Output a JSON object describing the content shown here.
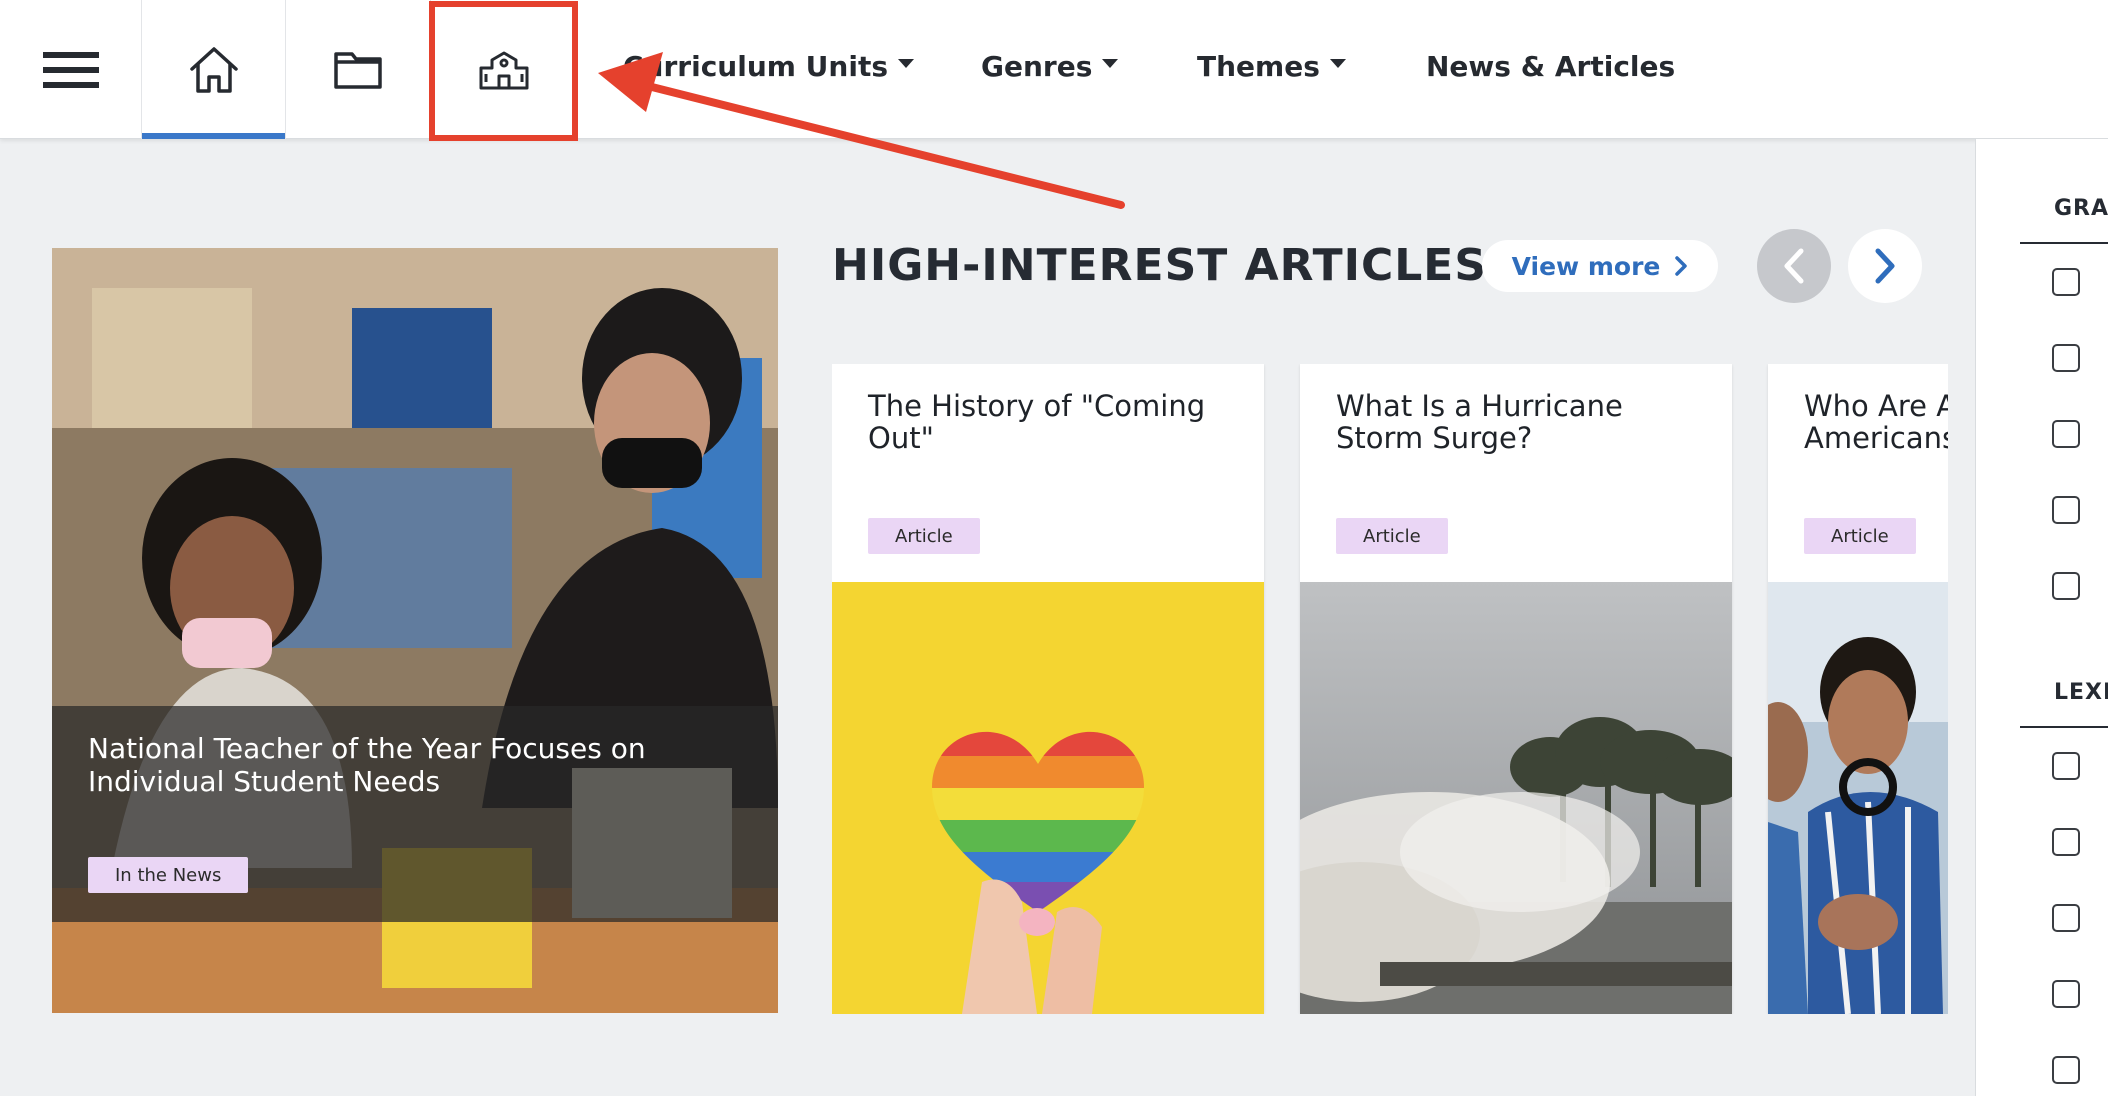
{
  "nav": {
    "icons": {
      "menu": "hamburger-menu-icon",
      "home": "home-icon",
      "folder": "folder-icon",
      "school": "school-building-icon"
    },
    "links": [
      {
        "label": "Curriculum Units",
        "dropdown": true
      },
      {
        "label": "Genres",
        "dropdown": true
      },
      {
        "label": "Themes",
        "dropdown": true
      },
      {
        "label": "News & Articles",
        "dropdown": false
      }
    ],
    "active_tab": "home"
  },
  "feature": {
    "title": "National Teacher of the Year Focuses on Individual Student Needs",
    "tag": "In the News"
  },
  "section": {
    "title": "HIGH-INTEREST ARTICLES",
    "view_more": "View more"
  },
  "cards": [
    {
      "title": "The History of \"Coming Out\"",
      "tag": "Article"
    },
    {
      "title": "What Is a Hurricane Storm Surge?",
      "tag": "Article"
    },
    {
      "title": "Who Are A\nAmericans",
      "tag": "Article"
    }
  ],
  "sidebar": {
    "headings": [
      "GRA",
      "LEXI"
    ]
  },
  "colors": {
    "accent_blue": "#3a78c9",
    "link_blue": "#2f6dbc",
    "annotation_red": "#e5412d",
    "tag_purple": "#ead6f5"
  }
}
